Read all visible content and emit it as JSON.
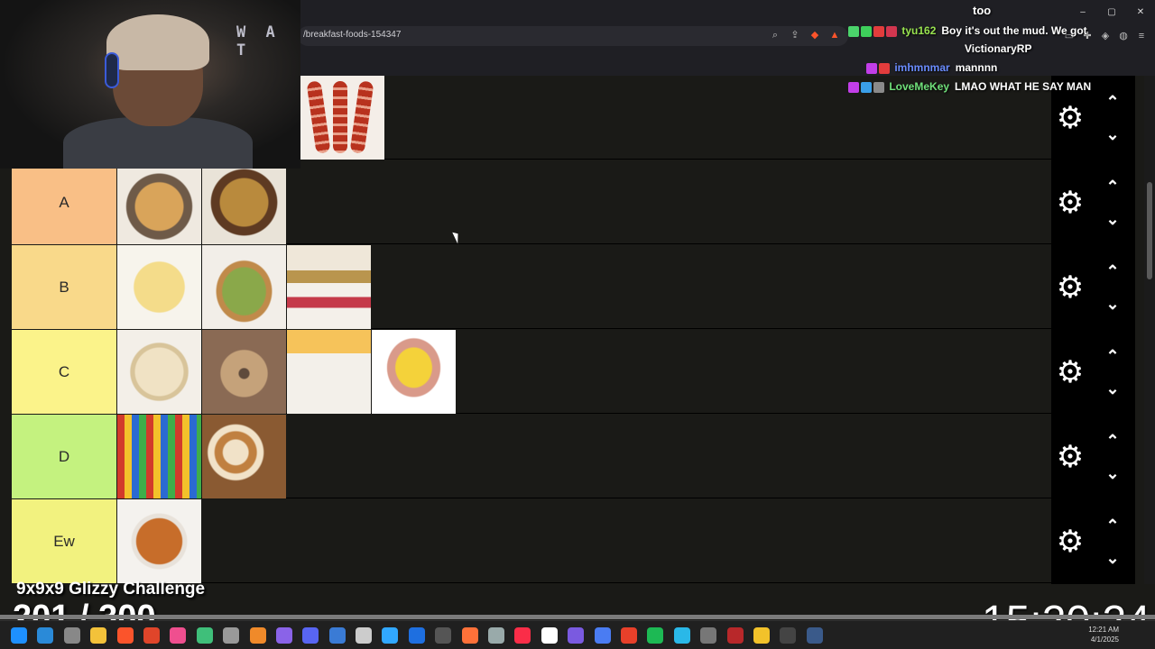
{
  "browser": {
    "url": "/breakfast-foods-154347",
    "window_title": "too",
    "minimize": "–",
    "maximize": "▢",
    "close": "✕"
  },
  "webcam": {
    "overlay_text": "W A T"
  },
  "tiers": [
    {
      "label": "",
      "color": "#1a1a17",
      "items": [
        "bacon"
      ]
    },
    {
      "label": "A",
      "color": "#f9bf86",
      "items": [
        "hash-browns",
        "home-fries"
      ]
    },
    {
      "label": "B",
      "color": "#f9d98a",
      "items": [
        "omelette",
        "avocado-toast",
        "yogurt-parfait"
      ]
    },
    {
      "label": "C",
      "color": "#fbf38a",
      "items": [
        "english-muffin",
        "bagel",
        "ham",
        "eggs-benedict"
      ]
    },
    {
      "label": "D",
      "color": "#c4f27f",
      "items": [
        "cereal",
        "cinnamon-rolls"
      ]
    },
    {
      "label": "Ew",
      "color": "#f2f27f",
      "items": [
        "baked-beans"
      ]
    }
  ],
  "chat": [
    {
      "user": "tyu162",
      "user_color": "#98e34f",
      "message": "Boy it's out the mud. We got",
      "message2": "VictionaryRP"
    },
    {
      "user": "imhmnmar",
      "user_color": "#6a8cff",
      "message": "mannnn"
    },
    {
      "user": "LoveMeKey",
      "user_color": "#6fe07a",
      "message": "LMAO WHAT HE SAY MAN"
    }
  ],
  "overlay": {
    "challenge_title": "9x9x9 Glizzy Challenge",
    "challenge_count": "201 / 300",
    "clock": "15:20:24"
  },
  "taskbar": {
    "time": "12:21 AM",
    "date": "4/1/2025",
    "icons": [
      "windows-start",
      "edge",
      "settings",
      "file-explorer",
      "brave",
      "chrome",
      "app-pink",
      "app-green",
      "app-gray",
      "app-orange",
      "app-purple",
      "discord",
      "vs-code",
      "app-terminal",
      "photoshop",
      "app-blue",
      "app-dark",
      "firefox",
      "app-wave",
      "itunes",
      "app-white",
      "app-purple2",
      "app-blue2",
      "app-red",
      "spotify",
      "app-cyan",
      "app-gray2",
      "app-darkred",
      "app-yellow",
      "obs",
      "steam"
    ]
  },
  "colors": {
    "page_bg": "#1a1a17",
    "control_bg": "#000000",
    "accent_white": "#ffffff"
  }
}
